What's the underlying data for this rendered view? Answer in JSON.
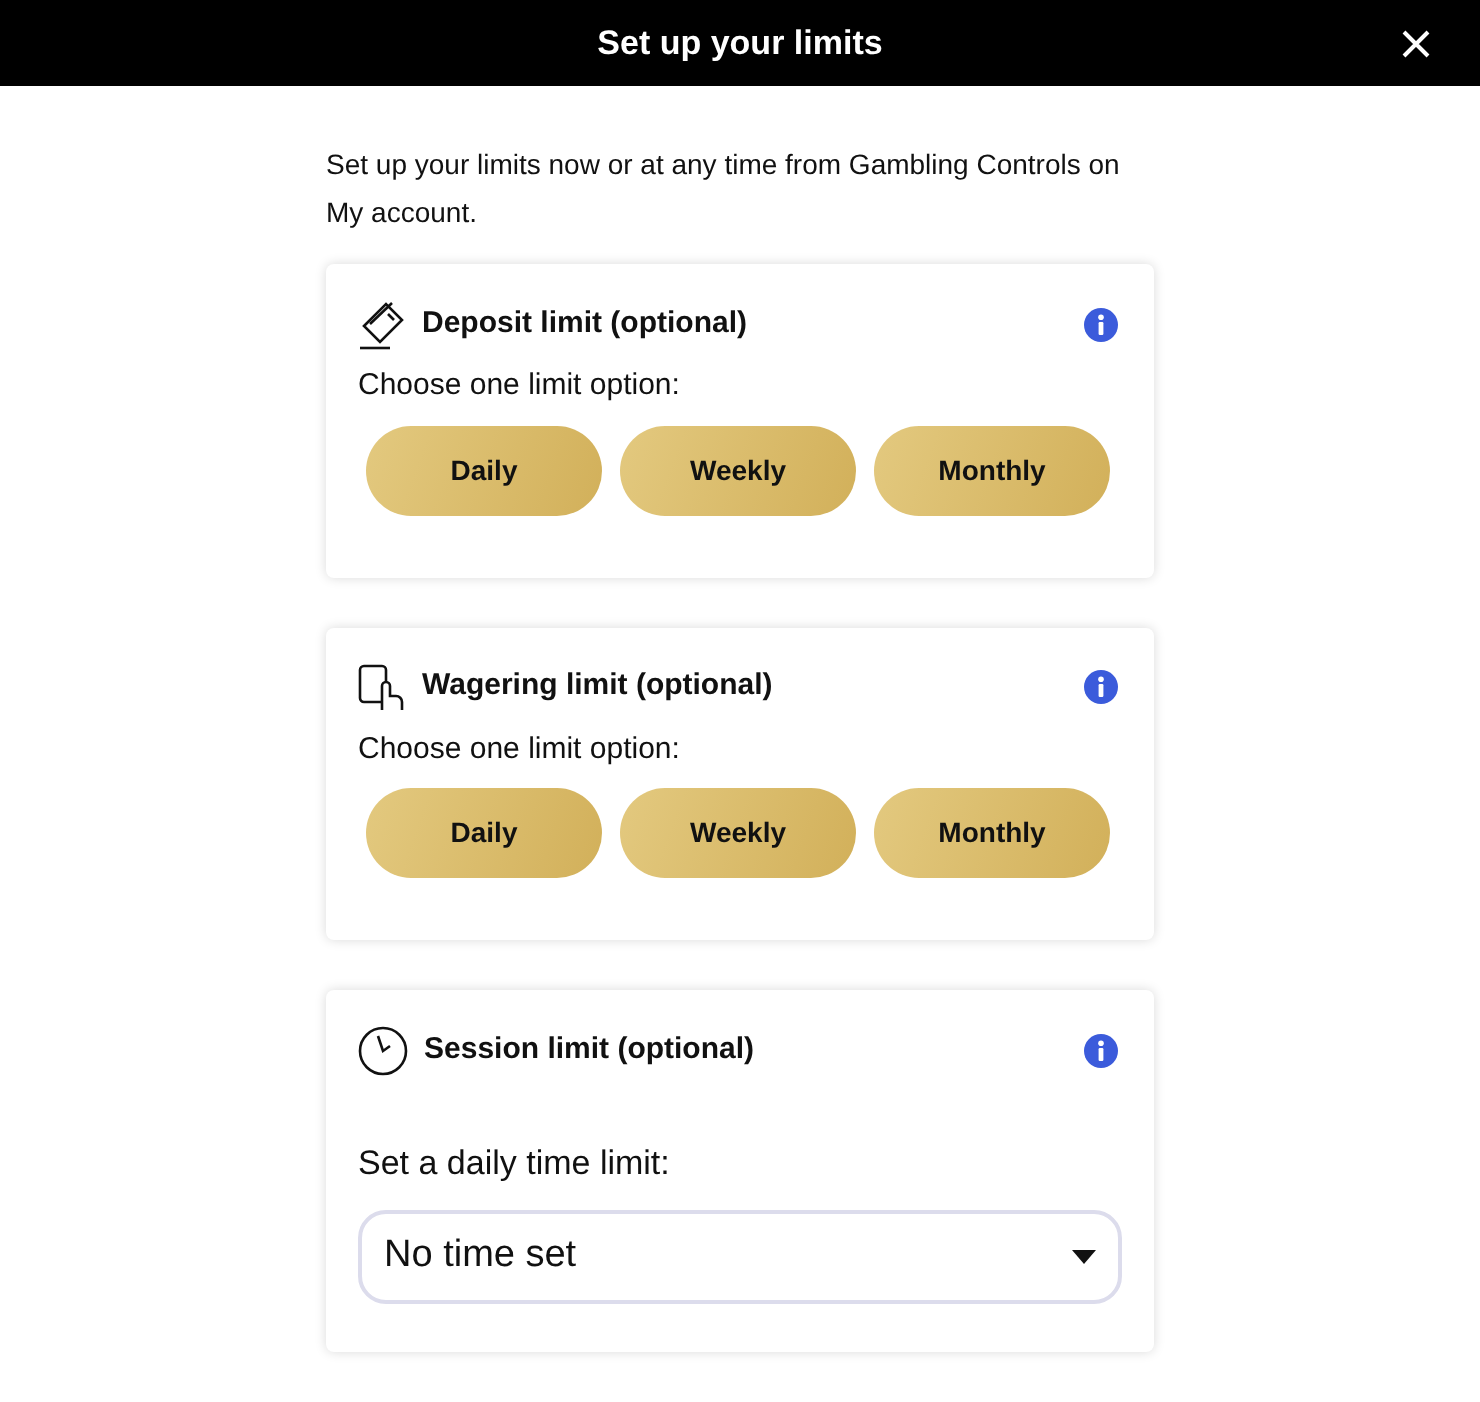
{
  "window": {
    "title": "Set up your limits"
  },
  "intro": "Set up your limits now or at any time from Gambling Controls on My account.",
  "cards": [
    {
      "kind": "options",
      "title": "Deposit limit (optional)",
      "prompt": "Choose one limit option:",
      "options": [
        "Daily",
        "Weekly",
        "Monthly"
      ]
    },
    {
      "kind": "options",
      "title": "Wagering limit (optional)",
      "prompt": "Choose one limit option:",
      "options": [
        "Daily",
        "Weekly",
        "Monthly"
      ]
    },
    {
      "kind": "select",
      "title": "Session limit (optional)",
      "prompt": "Set a daily time limit:",
      "value": "No time set"
    }
  ]
}
